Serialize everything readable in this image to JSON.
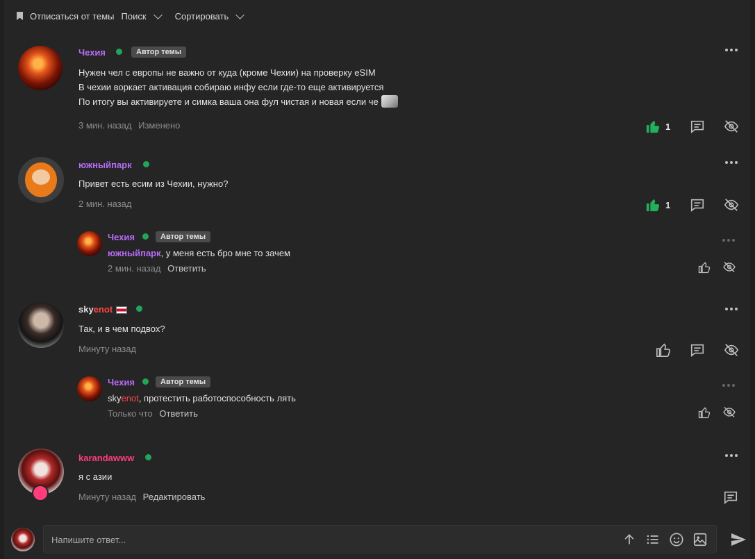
{
  "toolbar": {
    "unsubscribe_label": "Отписаться от темы",
    "search_label": "Поиск",
    "sort_label": "Сортировать"
  },
  "posts": [
    {
      "author": "Чехия",
      "badge": "Автор темы",
      "lines": [
        "Нужен чел с европы не важно от куда (кроме Чехии) на проверку eSIM",
        "В чехии воркает активация собираю инфу если где-то еще активируется",
        "По итогу вы активируете и симка ваша она фул чистая и новая если че"
      ],
      "time": "3 мин. назад",
      "edited": "Изменено",
      "likes": "1"
    },
    {
      "author": "южныйпарк",
      "lines": [
        "Привет есть есим из Чехии, нужно?"
      ],
      "time": "2 мин. назад",
      "likes": "1",
      "reply": {
        "author": "Чехия",
        "badge": "Автор темы",
        "mention": "южныйпарк",
        "text": ", у меня есть бро мне то зачем",
        "time": "2 мин. назад",
        "action": "Ответить"
      }
    },
    {
      "author_part1": "sky",
      "author_part2": "enot",
      "lines": [
        "Так, и в чем подвох?"
      ],
      "time": "Минуту назад",
      "reply": {
        "author": "Чехия",
        "badge": "Автор темы",
        "mention_part1": "sky",
        "mention_part2": "enot",
        "text": ", протестить работоспособность лять",
        "time": "Только что",
        "action": "Ответить"
      }
    },
    {
      "author": "karandawww",
      "lines": [
        "я с азии"
      ],
      "time": "Минуту назад",
      "edit": "Редактировать"
    }
  ],
  "composer": {
    "placeholder": "Напишите ответ..."
  },
  "colors": {
    "accent_purple": "#b56cf5",
    "online_green": "#22a55a",
    "like_green": "#22b05a",
    "mention_red": "#ff4747",
    "vip_pink": "#ff3d7a"
  }
}
